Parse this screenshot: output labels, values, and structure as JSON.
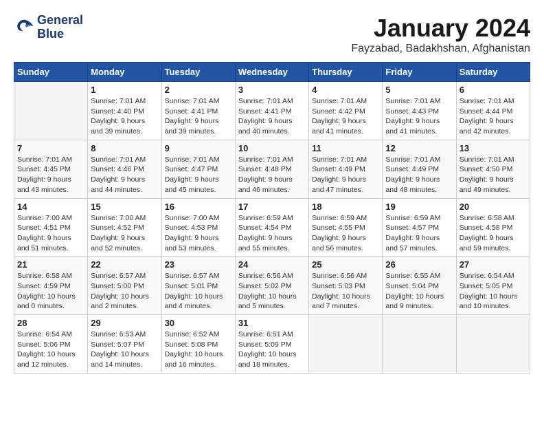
{
  "header": {
    "logo_line1": "General",
    "logo_line2": "Blue",
    "month": "January 2024",
    "location": "Fayzabad, Badakhshan, Afghanistan"
  },
  "weekdays": [
    "Sunday",
    "Monday",
    "Tuesday",
    "Wednesday",
    "Thursday",
    "Friday",
    "Saturday"
  ],
  "weeks": [
    [
      {
        "day": "",
        "sunrise": "",
        "sunset": "",
        "daylight": ""
      },
      {
        "day": "1",
        "sunrise": "Sunrise: 7:01 AM",
        "sunset": "Sunset: 4:40 PM",
        "daylight": "Daylight: 9 hours and 39 minutes."
      },
      {
        "day": "2",
        "sunrise": "Sunrise: 7:01 AM",
        "sunset": "Sunset: 4:41 PM",
        "daylight": "Daylight: 9 hours and 39 minutes."
      },
      {
        "day": "3",
        "sunrise": "Sunrise: 7:01 AM",
        "sunset": "Sunset: 4:41 PM",
        "daylight": "Daylight: 9 hours and 40 minutes."
      },
      {
        "day": "4",
        "sunrise": "Sunrise: 7:01 AM",
        "sunset": "Sunset: 4:42 PM",
        "daylight": "Daylight: 9 hours and 41 minutes."
      },
      {
        "day": "5",
        "sunrise": "Sunrise: 7:01 AM",
        "sunset": "Sunset: 4:43 PM",
        "daylight": "Daylight: 9 hours and 41 minutes."
      },
      {
        "day": "6",
        "sunrise": "Sunrise: 7:01 AM",
        "sunset": "Sunset: 4:44 PM",
        "daylight": "Daylight: 9 hours and 42 minutes."
      }
    ],
    [
      {
        "day": "7",
        "sunrise": "Sunrise: 7:01 AM",
        "sunset": "Sunset: 4:45 PM",
        "daylight": "Daylight: 9 hours and 43 minutes."
      },
      {
        "day": "8",
        "sunrise": "Sunrise: 7:01 AM",
        "sunset": "Sunset: 4:46 PM",
        "daylight": "Daylight: 9 hours and 44 minutes."
      },
      {
        "day": "9",
        "sunrise": "Sunrise: 7:01 AM",
        "sunset": "Sunset: 4:47 PM",
        "daylight": "Daylight: 9 hours and 45 minutes."
      },
      {
        "day": "10",
        "sunrise": "Sunrise: 7:01 AM",
        "sunset": "Sunset: 4:48 PM",
        "daylight": "Daylight: 9 hours and 46 minutes."
      },
      {
        "day": "11",
        "sunrise": "Sunrise: 7:01 AM",
        "sunset": "Sunset: 4:49 PM",
        "daylight": "Daylight: 9 hours and 47 minutes."
      },
      {
        "day": "12",
        "sunrise": "Sunrise: 7:01 AM",
        "sunset": "Sunset: 4:49 PM",
        "daylight": "Daylight: 9 hours and 48 minutes."
      },
      {
        "day": "13",
        "sunrise": "Sunrise: 7:01 AM",
        "sunset": "Sunset: 4:50 PM",
        "daylight": "Daylight: 9 hours and 49 minutes."
      }
    ],
    [
      {
        "day": "14",
        "sunrise": "Sunrise: 7:00 AM",
        "sunset": "Sunset: 4:51 PM",
        "daylight": "Daylight: 9 hours and 51 minutes."
      },
      {
        "day": "15",
        "sunrise": "Sunrise: 7:00 AM",
        "sunset": "Sunset: 4:52 PM",
        "daylight": "Daylight: 9 hours and 52 minutes."
      },
      {
        "day": "16",
        "sunrise": "Sunrise: 7:00 AM",
        "sunset": "Sunset: 4:53 PM",
        "daylight": "Daylight: 9 hours and 53 minutes."
      },
      {
        "day": "17",
        "sunrise": "Sunrise: 6:59 AM",
        "sunset": "Sunset: 4:54 PM",
        "daylight": "Daylight: 9 hours and 55 minutes."
      },
      {
        "day": "18",
        "sunrise": "Sunrise: 6:59 AM",
        "sunset": "Sunset: 4:55 PM",
        "daylight": "Daylight: 9 hours and 56 minutes."
      },
      {
        "day": "19",
        "sunrise": "Sunrise: 6:59 AM",
        "sunset": "Sunset: 4:57 PM",
        "daylight": "Daylight: 9 hours and 57 minutes."
      },
      {
        "day": "20",
        "sunrise": "Sunrise: 6:58 AM",
        "sunset": "Sunset: 4:58 PM",
        "daylight": "Daylight: 9 hours and 59 minutes."
      }
    ],
    [
      {
        "day": "21",
        "sunrise": "Sunrise: 6:58 AM",
        "sunset": "Sunset: 4:59 PM",
        "daylight": "Daylight: 10 hours and 0 minutes."
      },
      {
        "day": "22",
        "sunrise": "Sunrise: 6:57 AM",
        "sunset": "Sunset: 5:00 PM",
        "daylight": "Daylight: 10 hours and 2 minutes."
      },
      {
        "day": "23",
        "sunrise": "Sunrise: 6:57 AM",
        "sunset": "Sunset: 5:01 PM",
        "daylight": "Daylight: 10 hours and 4 minutes."
      },
      {
        "day": "24",
        "sunrise": "Sunrise: 6:56 AM",
        "sunset": "Sunset: 5:02 PM",
        "daylight": "Daylight: 10 hours and 5 minutes."
      },
      {
        "day": "25",
        "sunrise": "Sunrise: 6:56 AM",
        "sunset": "Sunset: 5:03 PM",
        "daylight": "Daylight: 10 hours and 7 minutes."
      },
      {
        "day": "26",
        "sunrise": "Sunrise: 6:55 AM",
        "sunset": "Sunset: 5:04 PM",
        "daylight": "Daylight: 10 hours and 9 minutes."
      },
      {
        "day": "27",
        "sunrise": "Sunrise: 6:54 AM",
        "sunset": "Sunset: 5:05 PM",
        "daylight": "Daylight: 10 hours and 10 minutes."
      }
    ],
    [
      {
        "day": "28",
        "sunrise": "Sunrise: 6:54 AM",
        "sunset": "Sunset: 5:06 PM",
        "daylight": "Daylight: 10 hours and 12 minutes."
      },
      {
        "day": "29",
        "sunrise": "Sunrise: 6:53 AM",
        "sunset": "Sunset: 5:07 PM",
        "daylight": "Daylight: 10 hours and 14 minutes."
      },
      {
        "day": "30",
        "sunrise": "Sunrise: 6:52 AM",
        "sunset": "Sunset: 5:08 PM",
        "daylight": "Daylight: 10 hours and 16 minutes."
      },
      {
        "day": "31",
        "sunrise": "Sunrise: 6:51 AM",
        "sunset": "Sunset: 5:09 PM",
        "daylight": "Daylight: 10 hours and 18 minutes."
      },
      {
        "day": "",
        "sunrise": "",
        "sunset": "",
        "daylight": ""
      },
      {
        "day": "",
        "sunrise": "",
        "sunset": "",
        "daylight": ""
      },
      {
        "day": "",
        "sunrise": "",
        "sunset": "",
        "daylight": ""
      }
    ]
  ]
}
